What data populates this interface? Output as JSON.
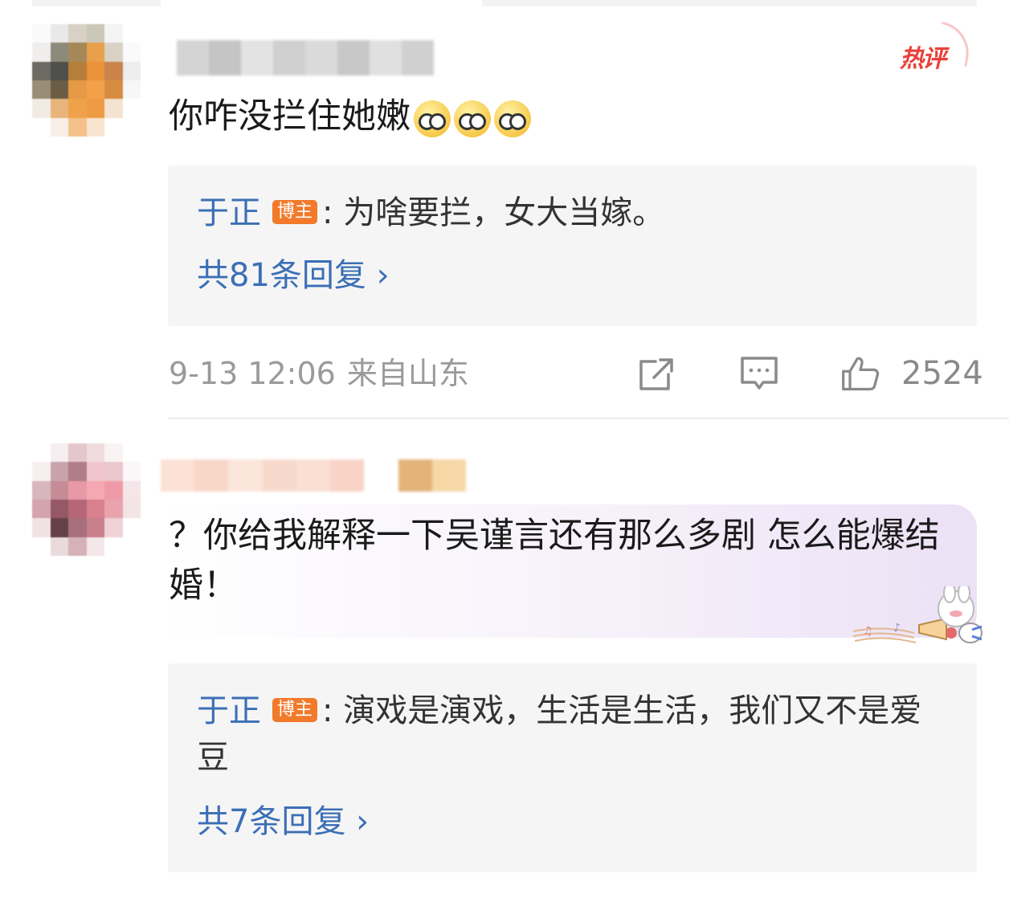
{
  "comments": [
    {
      "hot_label": "热评",
      "text": "你咋没拦住她嫩",
      "emojis": [
        "facepalm-icon",
        "facepalm-icon",
        "facepalm-icon"
      ],
      "reply": {
        "author": "于正",
        "tag": "博主",
        "text": ": 为啥要拦，女大当嫁。",
        "more": "共81条回复 ›"
      },
      "time": "9-13 12:06",
      "location": "来自山东",
      "likes": "2524"
    },
    {
      "text": "？你给我解释一下吴谨言还有那么多剧 怎么能爆结婚！",
      "reply": {
        "author": "于正",
        "tag": "博主",
        "text": ": 演戏是演戏，生活是生活，我们又不是爱豆",
        "more": "共7条回复 ›"
      }
    }
  ],
  "colors": {
    "link": "#3b6fb6",
    "blogger_tag": "#f27a2b",
    "hot": "#e8413a",
    "meta": "#9a9a9a"
  }
}
